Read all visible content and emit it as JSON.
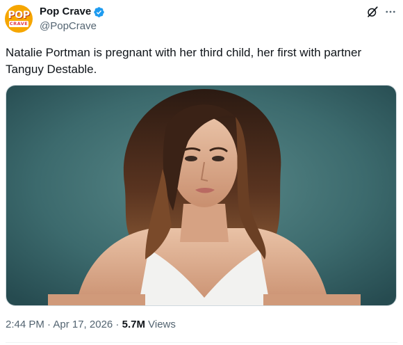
{
  "author": {
    "display_name": "Pop Crave",
    "handle": "@PopCrave",
    "avatar_text_top": "POP",
    "avatar_text_bottom": "CRAVE",
    "verified": true
  },
  "tweet": {
    "text": "Natalie Portman is pregnant with her third child, her first with partner Tanguy Destable."
  },
  "meta": {
    "timestamp": "2:44 PM · Apr 17, 2026",
    "separator": " · ",
    "views_count": "5.7M",
    "views_label": " Views"
  },
  "icons": {
    "verified": "verified-badge-icon",
    "grok": "grok-icon",
    "more": "more-options-icon"
  },
  "colors": {
    "avatar_bg": "#f6a600",
    "verified_blue": "#1d9bf0",
    "secondary_text": "#536471",
    "photo_background": "#3c6a6d"
  }
}
